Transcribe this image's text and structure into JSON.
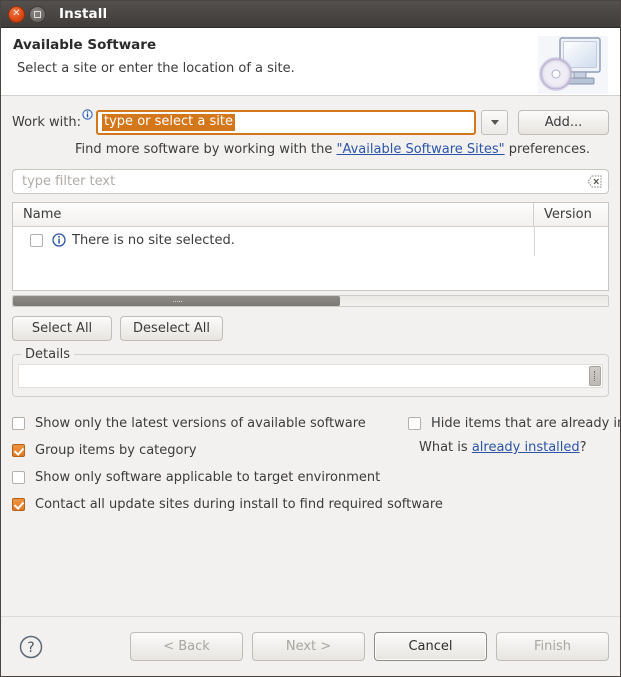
{
  "window": {
    "title": "Install",
    "close_icon": "close-icon",
    "maximize_icon": "maximize-icon"
  },
  "banner": {
    "title": "Available Software",
    "subtitle": "Select a site or enter the location of a site.",
    "icon": "install-monitor-disc-icon"
  },
  "work_with": {
    "label": "Work with:",
    "info_icon": "info-decoration-icon",
    "value": "type or select a site",
    "dropdown_icon": "chevron-down-icon",
    "add_button": "Add..."
  },
  "hint": {
    "prefix": "Find more software by working with the ",
    "link": "\"Available Software Sites\"",
    "suffix": " preferences."
  },
  "filter": {
    "placeholder": "type filter text",
    "clear_icon": "clear-text-icon"
  },
  "table": {
    "columns": [
      "Name",
      "Version"
    ],
    "rows": [
      {
        "checked": false,
        "icon": "info-icon",
        "name": "There is no site selected.",
        "version": ""
      }
    ],
    "hscroll_thumb_percent": 55
  },
  "selection_buttons": {
    "select_all": "Select All",
    "deselect_all": "Deselect All"
  },
  "details": {
    "title": "Details",
    "text": ""
  },
  "options": {
    "left": [
      {
        "label": "Show only the latest versions of available software",
        "checked": false
      },
      {
        "label": "Group items by category",
        "checked": true
      },
      {
        "label": "Show only software applicable to target environment",
        "checked": false
      },
      {
        "label": "Contact all update sites during install to find required software",
        "checked": true
      }
    ],
    "right": [
      {
        "label": "Hide items that are already installed",
        "checked": false
      }
    ],
    "whatis_prefix": "What is ",
    "whatis_link": "already installed",
    "whatis_suffix": "?"
  },
  "footer": {
    "help_icon": "help-icon",
    "back": "< Back",
    "next": "Next >",
    "cancel": "Cancel",
    "finish": "Finish"
  },
  "colors": {
    "accent_orange": "#d4761a",
    "checkbox_orange": "#e07b27",
    "link_blue": "#2a54a8",
    "titlebar": "#484542",
    "dialog_bg": "#f2f1f0"
  }
}
